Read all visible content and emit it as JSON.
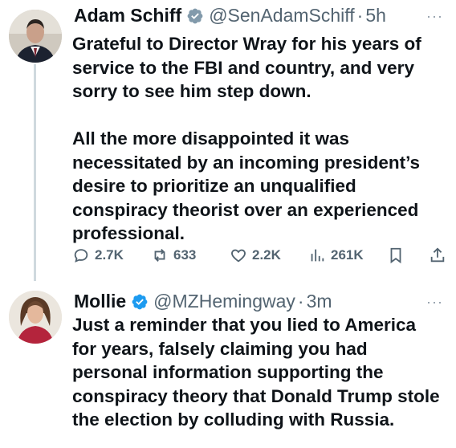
{
  "tweets": [
    {
      "author": "Adam Schiff",
      "handle": "@SenAdamSchiff",
      "dot": "·",
      "time": "5h",
      "more": "···",
      "text": "Grateful to Director Wray for his years of service to the FBI and country, and very sorry to see him step down.\n\nAll the more disappointed it was necessitated by an incoming president’s desire to prioritize an unqualified conspiracy theorist over an experienced professional.",
      "replies": "2.7K",
      "reposts": "633",
      "likes": "2.2K",
      "views": "261K",
      "verified_color": "#829aab"
    },
    {
      "author": "Mollie",
      "handle": "@MZHemingway",
      "dot": "·",
      "time": "3m",
      "more": "···",
      "text": "Just a reminder that you lied to America for years, falsely claiming you had personal information supporting the conspiracy theory that Donald Trump stole the election by colluding with Russia.",
      "verified_color": "#1d9bf0"
    }
  ]
}
